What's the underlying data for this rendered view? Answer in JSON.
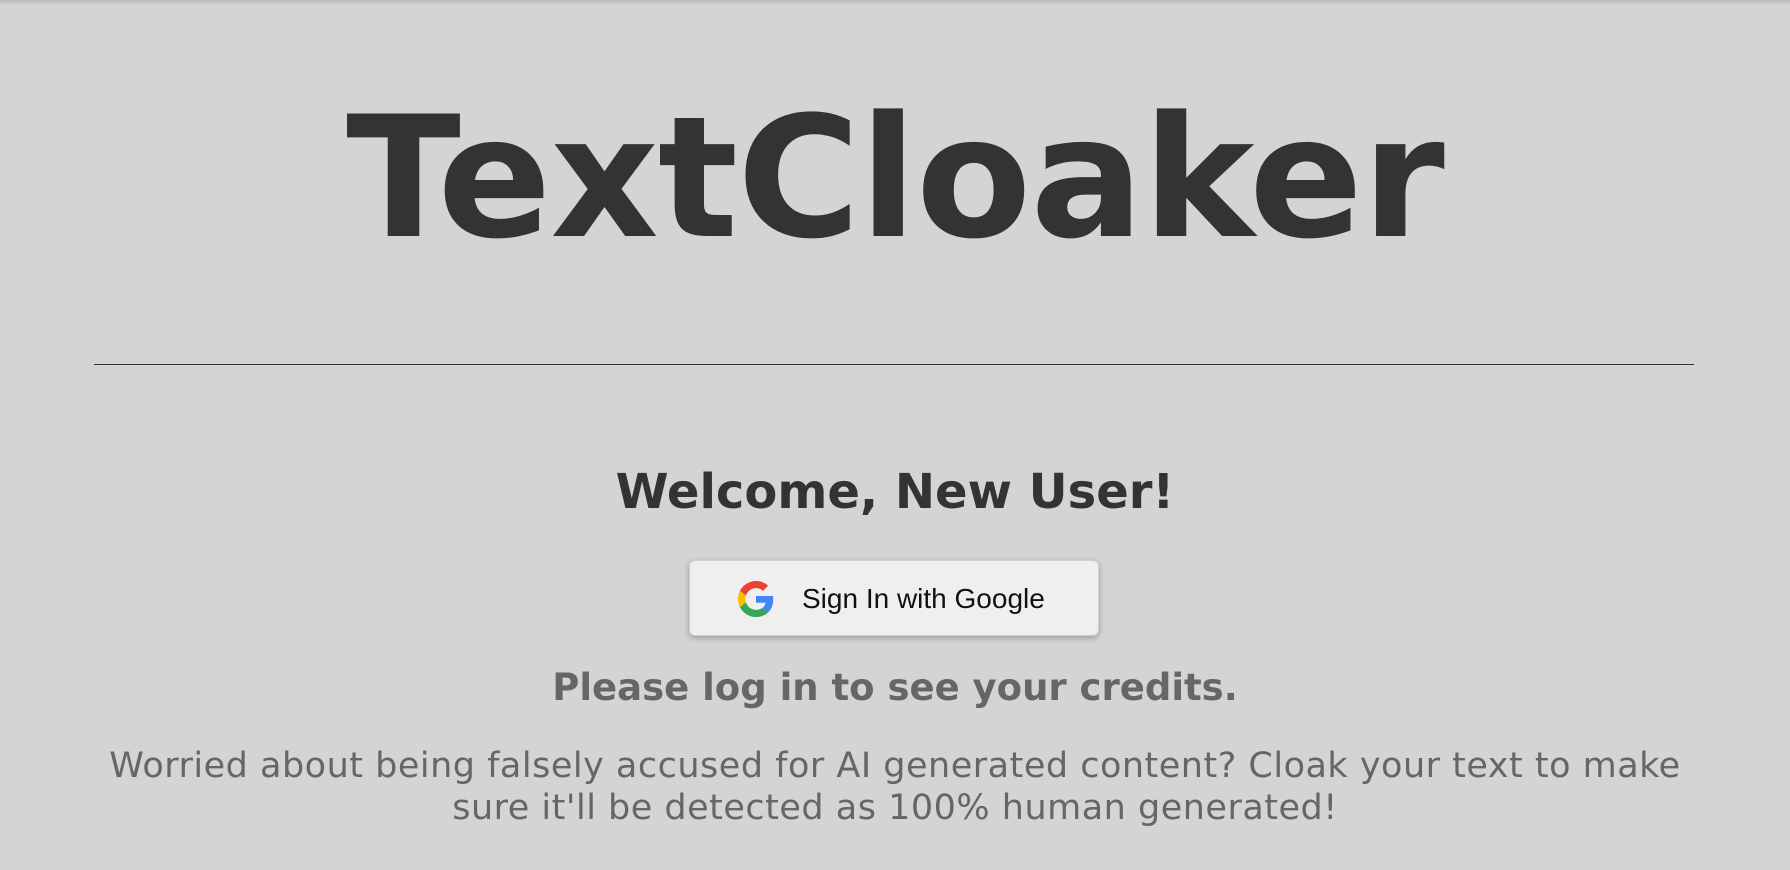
{
  "header": {
    "title": "TextCloaker"
  },
  "main": {
    "welcome": "Welcome, New User!",
    "sign_in_button": {
      "label": "Sign In with Google",
      "icon": "google-g-icon"
    },
    "credits_message": "Please log in to see your credits.",
    "tagline": "Worried about being falsely accused for AI generated content? Cloak your text to make sure it'll be detected as 100% human generated!"
  },
  "colors": {
    "background": "#d4d4d4",
    "heading": "#333333",
    "muted_text": "#666666",
    "button_bg": "#efefef",
    "google_blue": "#4285F4",
    "google_red": "#EA4335",
    "google_yellow": "#FBBC05",
    "google_green": "#34A853"
  }
}
